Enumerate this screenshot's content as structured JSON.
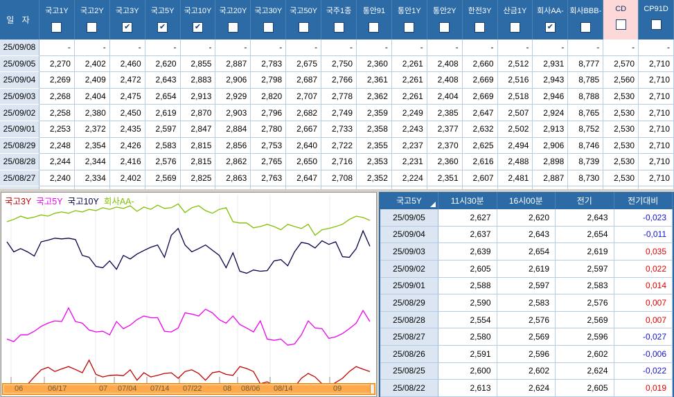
{
  "icons": {
    "check": "✔"
  },
  "top_table": {
    "date_header": "일  자",
    "columns": [
      {
        "label": "국고1Y",
        "checked": false
      },
      {
        "label": "국고2Y",
        "checked": false
      },
      {
        "label": "국고3Y",
        "checked": true
      },
      {
        "label": "국고5Y",
        "checked": true
      },
      {
        "label": "국고10Y",
        "checked": true
      },
      {
        "label": "국고20Y",
        "checked": false
      },
      {
        "label": "국고30Y",
        "checked": false
      },
      {
        "label": "국고50Y",
        "checked": false
      },
      {
        "label": "국주1종",
        "checked": false
      },
      {
        "label": "통안91",
        "checked": false
      },
      {
        "label": "통안1Y",
        "checked": false
      },
      {
        "label": "통안2Y",
        "checked": false
      },
      {
        "label": "한전3Y",
        "checked": false
      },
      {
        "label": "산금1Y",
        "checked": false
      },
      {
        "label": "회사AA-",
        "checked": true
      },
      {
        "label": "회사BBB-",
        "checked": false
      },
      {
        "label": "CD",
        "checked": false,
        "highlight": true
      },
      {
        "label": "CP91D",
        "checked": false
      }
    ],
    "rows": [
      {
        "date": "25/09/08",
        "values": [
          "-",
          "-",
          "-",
          "-",
          "-",
          "-",
          "-",
          "-",
          "-",
          "-",
          "-",
          "-",
          "-",
          "-",
          "-",
          "-",
          "-",
          "-"
        ]
      },
      {
        "date": "25/09/05",
        "values": [
          "2,270",
          "2,402",
          "2,460",
          "2,620",
          "2,855",
          "2,887",
          "2,783",
          "2,675",
          "2,750",
          "2,360",
          "2,261",
          "2,408",
          "2,660",
          "2,512",
          "2,931",
          "8,777",
          "2,570",
          "2,710"
        ]
      },
      {
        "date": "25/09/04",
        "values": [
          "2,269",
          "2,409",
          "2,472",
          "2,643",
          "2,883",
          "2,906",
          "2,798",
          "2,687",
          "2,766",
          "2,361",
          "2,261",
          "2,408",
          "2,669",
          "2,516",
          "2,943",
          "8,785",
          "2,560",
          "2,710"
        ]
      },
      {
        "date": "25/09/03",
        "values": [
          "2,268",
          "2,404",
          "2,475",
          "2,654",
          "2,913",
          "2,929",
          "2,820",
          "2,707",
          "2,778",
          "2,362",
          "2,261",
          "2,404",
          "2,669",
          "2,518",
          "2,946",
          "8,788",
          "2,530",
          "2,710"
        ]
      },
      {
        "date": "25/09/02",
        "values": [
          "2,258",
          "2,380",
          "2,450",
          "2,619",
          "2,870",
          "2,903",
          "2,796",
          "2,682",
          "2,749",
          "2,359",
          "2,249",
          "2,385",
          "2,647",
          "2,507",
          "2,924",
          "8,765",
          "2,530",
          "2,710"
        ]
      },
      {
        "date": "25/09/01",
        "values": [
          "2,253",
          "2,372",
          "2,435",
          "2,597",
          "2,847",
          "2,884",
          "2,780",
          "2,667",
          "2,733",
          "2,358",
          "2,243",
          "2,377",
          "2,632",
          "2,502",
          "2,913",
          "8,752",
          "2,530",
          "2,710"
        ]
      },
      {
        "date": "25/08/29",
        "values": [
          "2,248",
          "2,354",
          "2,426",
          "2,583",
          "2,815",
          "2,856",
          "2,753",
          "2,640",
          "2,722",
          "2,355",
          "2,237",
          "2,370",
          "2,625",
          "2,494",
          "2,906",
          "8,746",
          "2,530",
          "2,710"
        ]
      },
      {
        "date": "25/08/28",
        "values": [
          "2,244",
          "2,344",
          "2,416",
          "2,576",
          "2,815",
          "2,862",
          "2,765",
          "2,650",
          "2,716",
          "2,353",
          "2,231",
          "2,360",
          "2,616",
          "2,488",
          "2,898",
          "8,739",
          "2,530",
          "2,710"
        ]
      },
      {
        "date": "25/08/27",
        "values": [
          "2,240",
          "2,334",
          "2,402",
          "2,569",
          "2,825",
          "2,863",
          "2,763",
          "2,647",
          "2,708",
          "2,352",
          "2,224",
          "2,351",
          "2,607",
          "2,481",
          "2,887",
          "8,730",
          "2,530",
          "2,710"
        ]
      }
    ]
  },
  "chart": {
    "legend": [
      {
        "label": "국고3Y",
        "color": "#c00000"
      },
      {
        "label": "국고5Y",
        "color": "#ee00ee"
      },
      {
        "label": "국고10Y",
        "color": "#000048"
      },
      {
        "label": "회사AA-",
        "color": "#80c000"
      }
    ],
    "ticks": [
      {
        "label": "06",
        "x": 14
      },
      {
        "label": "06/17",
        "x": 62
      },
      {
        "label": "07",
        "x": 136
      },
      {
        "label": "07/04",
        "x": 163
      },
      {
        "label": "07/14",
        "x": 210
      },
      {
        "label": "07/22",
        "x": 257
      },
      {
        "label": "08",
        "x": 315
      },
      {
        "label": "08/06",
        "x": 341
      },
      {
        "label": "08/14",
        "x": 388
      },
      {
        "label": "09",
        "x": 474
      }
    ],
    "chart_data": {
      "type": "line",
      "x_axis_labels": [
        "06",
        "06/17",
        "07",
        "07/04",
        "07/14",
        "07/22",
        "08",
        "08/06",
        "08/14",
        "09"
      ],
      "ylim": [
        2.428,
        2.99
      ],
      "grid": "vertical-only",
      "legend_position": "top-left-overlay",
      "series": [
        {
          "name": "국고3Y",
          "color": "#c00000",
          "values": [
            2.408,
            2.414,
            2.42,
            2.424,
            2.447,
            2.469,
            2.477,
            2.464,
            2.472,
            2.479,
            2.47,
            2.46,
            2.499,
            2.455,
            2.447,
            2.452,
            2.453,
            2.451,
            2.469,
            2.437,
            2.46,
            2.447,
            2.452,
            2.458,
            2.46,
            2.443,
            2.464,
            2.469,
            2.458,
            2.437,
            2.46,
            2.464,
            2.455,
            2.452,
            2.479,
            2.473,
            2.464,
            2.426,
            2.432,
            2.42,
            2.416,
            2.42,
            2.416,
            2.443,
            2.458,
            2.447,
            2.426,
            2.418,
            2.43,
            2.443,
            2.464,
            2.479,
            2.471,
            2.464
          ]
        },
        {
          "name": "국고5Y",
          "color": "#ee00ee",
          "values": [
            2.564,
            2.556,
            2.577,
            2.577,
            2.588,
            2.603,
            2.613,
            2.62,
            2.618,
            2.66,
            2.618,
            2.613,
            2.592,
            2.586,
            2.588,
            2.577,
            2.618,
            2.596,
            2.607,
            2.624,
            2.635,
            2.63,
            2.63,
            2.588,
            2.586,
            2.598,
            2.645,
            2.641,
            2.635,
            2.656,
            2.645,
            2.624,
            2.613,
            2.635,
            2.609,
            2.598,
            2.586,
            2.62,
            2.564,
            2.56,
            2.564,
            2.545,
            2.549,
            2.577,
            2.62,
            2.598,
            2.596,
            2.566,
            2.571,
            2.581,
            2.596,
            2.613,
            2.652,
            2.618
          ]
        },
        {
          "name": "국고10Y",
          "color": "#000048",
          "values": [
            2.864,
            2.833,
            2.843,
            2.833,
            2.82,
            2.864,
            2.869,
            2.875,
            2.873,
            2.875,
            2.871,
            2.822,
            2.816,
            2.788,
            2.784,
            2.805,
            2.779,
            2.822,
            2.811,
            2.826,
            2.837,
            2.847,
            2.854,
            2.816,
            2.884,
            2.905,
            2.854,
            2.833,
            2.843,
            2.854,
            2.838,
            2.822,
            2.784,
            2.83,
            2.773,
            2.767,
            2.777,
            2.773,
            2.775,
            2.805,
            2.809,
            2.79,
            2.833,
            2.862,
            2.858,
            2.845,
            2.867,
            2.856,
            2.864,
            2.818,
            2.816,
            2.843,
            2.898,
            2.85
          ]
        },
        {
          "name": "회사AA-",
          "color": "#80c000",
          "values": [
            2.926,
            2.933,
            2.943,
            2.936,
            2.94,
            2.947,
            2.943,
            2.952,
            2.956,
            2.952,
            2.96,
            2.956,
            2.964,
            2.96,
            2.969,
            2.964,
            2.971,
            2.967,
            2.975,
            2.958,
            2.971,
            2.964,
            2.977,
            2.967,
            2.969,
            2.981,
            2.954,
            2.969,
            2.975,
            2.96,
            2.952,
            2.964,
            2.969,
            2.926,
            2.922,
            2.922,
            2.907,
            2.911,
            2.918,
            2.911,
            2.901,
            2.918,
            2.911,
            2.905,
            2.918,
            2.884,
            2.901,
            2.905,
            2.911,
            2.918,
            2.933,
            2.943,
            2.939,
            2.93
          ]
        }
      ]
    }
  },
  "right_table": {
    "headers": [
      "국고5Y",
      "11시30분",
      "16시00분",
      "전기",
      "전기대비"
    ],
    "rows": [
      {
        "date": "25/09/05",
        "v1": "2,627",
        "v2": "2,620",
        "prev": "2,643",
        "delta": "-0,023"
      },
      {
        "date": "25/09/04",
        "v1": "2,637",
        "v2": "2,643",
        "prev": "2,654",
        "delta": "-0,011"
      },
      {
        "date": "25/09/03",
        "v1": "2,639",
        "v2": "2,654",
        "prev": "2,619",
        "delta": "0,035"
      },
      {
        "date": "25/09/02",
        "v1": "2,605",
        "v2": "2,619",
        "prev": "2,597",
        "delta": "0,022"
      },
      {
        "date": "25/09/01",
        "v1": "2,588",
        "v2": "2,597",
        "prev": "2,583",
        "delta": "0,014"
      },
      {
        "date": "25/08/29",
        "v1": "2,590",
        "v2": "2,583",
        "prev": "2,576",
        "delta": "0,007"
      },
      {
        "date": "25/08/28",
        "v1": "2,554",
        "v2": "2,576",
        "prev": "2,569",
        "delta": "0,007"
      },
      {
        "date": "25/08/27",
        "v1": "2,580",
        "v2": "2,569",
        "prev": "2,596",
        "delta": "-0,027"
      },
      {
        "date": "25/08/26",
        "v1": "2,591",
        "v2": "2,596",
        "prev": "2,602",
        "delta": "-0,006"
      },
      {
        "date": "25/08/25",
        "v1": "2,600",
        "v2": "2,602",
        "prev": "2,624",
        "delta": "-0,022"
      },
      {
        "date": "25/08/22",
        "v1": "2,613",
        "v2": "2,624",
        "prev": "2,605",
        "delta": "0,019"
      }
    ]
  }
}
